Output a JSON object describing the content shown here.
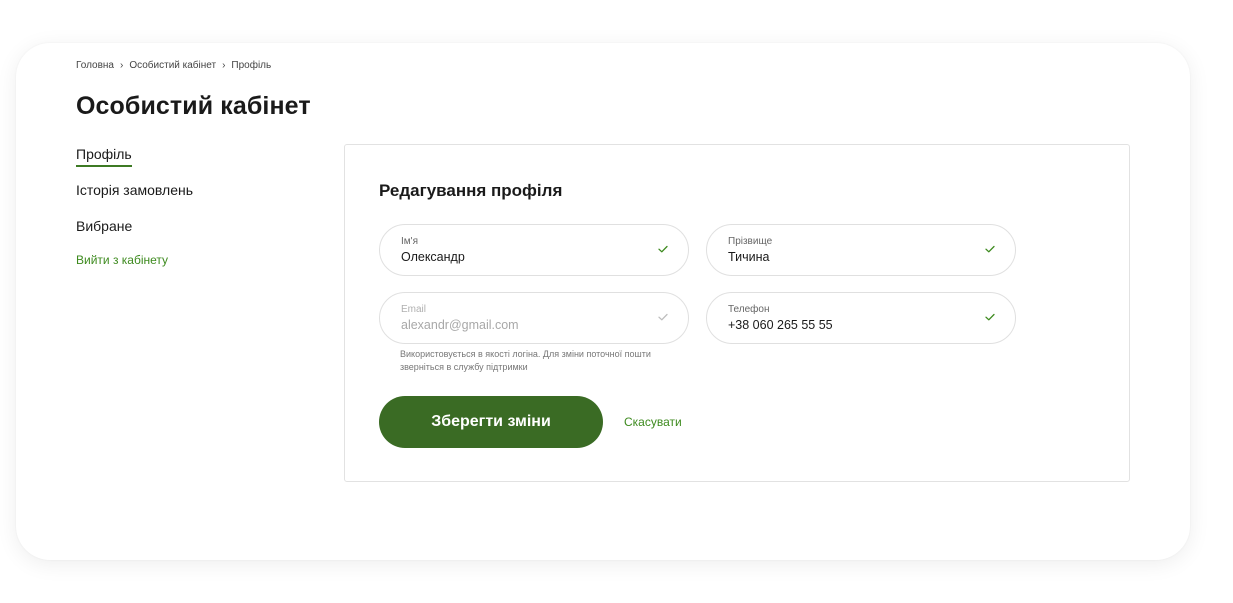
{
  "breadcrumb": {
    "items": [
      "Головна",
      "Особистий кабінет",
      "Профіль"
    ],
    "separator": "›"
  },
  "page": {
    "title": "Особистий кабінет"
  },
  "sidebar": {
    "items": [
      {
        "label": "Профіль",
        "active": true
      },
      {
        "label": "Історія замовлень",
        "active": false
      },
      {
        "label": "Вибране",
        "active": false
      }
    ],
    "logout_label": "Вийти з  кабінету"
  },
  "form": {
    "title": "Редагування профіля",
    "fields": {
      "first_name": {
        "label": "Ім'я",
        "value": "Олександр"
      },
      "last_name": {
        "label": "Прізвище",
        "value": "Тичина"
      },
      "email": {
        "label": "Email",
        "value": "alexandr@gmail.com"
      },
      "phone": {
        "label": "Телефон",
        "value": "+38 060 265 55 55"
      }
    },
    "email_hint": "Використовується в якості логіна. Для зміни поточної пошти зверніться в службу підтримки",
    "save_label": "Зберегти зміни",
    "cancel_label": "Скасувати"
  },
  "icons": {
    "field_check": "check-icon",
    "breadcrumb_separator": "chevron-right-icon"
  },
  "colors": {
    "accent": "#3a6b24",
    "link": "#3d8a1e",
    "check": "#3d8a1e"
  }
}
